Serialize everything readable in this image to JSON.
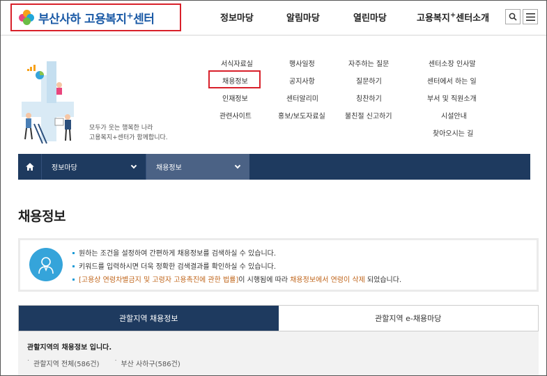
{
  "header": {
    "logo_text": "부산사하 고용복지",
    "logo_sup": "+",
    "logo_text2": "센터",
    "gnb": [
      {
        "label": "정보마당"
      },
      {
        "label": "알림마당"
      },
      {
        "label": "열린마당"
      },
      {
        "label": "고용복지",
        "sup": "+",
        "label2": "센터소개"
      }
    ],
    "search_icon": "search-icon",
    "menu_icon": "hamburger-menu-icon"
  },
  "mega": {
    "slogan_line1": "모두가 웃는 행복한 나라",
    "slogan_line2": "고용복지+센터가 함께합니다.",
    "col1": [
      "서식자료실",
      "채용정보",
      "인재정보",
      "관련사이트"
    ],
    "col2": [
      "행사일정",
      "공지사항",
      "센터알리미",
      "홍보/보도자료실"
    ],
    "col3": [
      "자주하는 질문",
      "질문하기",
      "칭찬하기",
      "불친절 신고하기"
    ],
    "col4": [
      "센터소장 인사말",
      "센터에서 하는 일",
      "부서 및 직원소개",
      "시설안내",
      "찾아오시는 길"
    ]
  },
  "location": {
    "home_icon": "home-icon",
    "depth1": "정보마당",
    "depth2": "채용정보"
  },
  "page_title": "채용정보",
  "info": {
    "line1": "원하는 조건을 설정하여 간편하게 채용정보를 검색하실 수 있습니다.",
    "line2": "키워드를 입력하시면 더욱 정확한 검색결과를 확인하실 수 있습니다.",
    "line3_a": "[고용상 연령차별금지 및 고령자 고용촉진에 관한 법률]",
    "line3_b": "이 시행됨에 따라 ",
    "line3_c": "채용정보에서 연령이 삭제",
    "line3_d": " 되었습니다."
  },
  "tabs": [
    {
      "label": "관할지역 채용정보",
      "active": true
    },
    {
      "label": "관할지역 e-채용마당",
      "active": false
    }
  ],
  "panel": {
    "title": "관할지역의 채용정보 입니다.",
    "links": [
      "관할지역 전체(586건)",
      "부산 사하구(586건)"
    ]
  },
  "colors": {
    "navy": "#1e3a5f",
    "highlight_red": "#d8202a",
    "info_blue": "#35a4da",
    "orange_text": "#c0651b"
  }
}
